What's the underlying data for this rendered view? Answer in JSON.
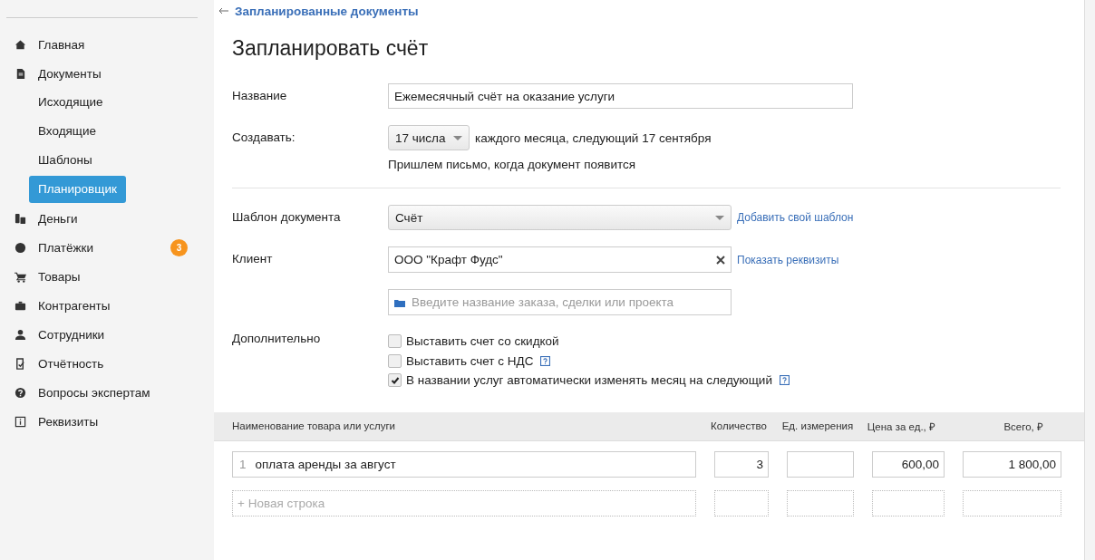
{
  "sidebar": {
    "items": [
      {
        "label": "Главная",
        "selected": false
      },
      {
        "label": "Документы",
        "selected": false,
        "children": [
          {
            "label": "Исходящие",
            "selected": false
          },
          {
            "label": "Входящие",
            "selected": false
          },
          {
            "label": "Шаблоны",
            "selected": false
          },
          {
            "label": "Планировщик",
            "selected": true
          }
        ]
      },
      {
        "label": "Деньги",
        "selected": false
      },
      {
        "label": "Платёжки",
        "selected": false,
        "badge": "3"
      },
      {
        "label": "Товары",
        "selected": false
      },
      {
        "label": "Контрагенты",
        "selected": false
      },
      {
        "label": "Сотрудники",
        "selected": false
      },
      {
        "label": "Отчётность",
        "selected": false
      },
      {
        "label": "Вопросы экспертам",
        "selected": false
      },
      {
        "label": "Реквизиты",
        "selected": false
      }
    ]
  },
  "back_link": "Запланированные документы",
  "title": "Запланировать счёт",
  "form": {
    "name": {
      "label": "Название",
      "value": "Ежемесячный счёт на оказание услуги"
    },
    "create": {
      "label": "Создавать:",
      "day": "17 числа",
      "text": "каждого месяца, следующий 17 сентября",
      "note": "Пришлем письмо, когда документ появится"
    },
    "template": {
      "label": "Шаблон документа",
      "value": "Счёт",
      "link": "Добавить свой шаблон"
    },
    "client": {
      "label": "Клиент",
      "value": "ООО \"Крафт Фудс\"",
      "link": "Показать реквизиты"
    },
    "project": {
      "placeholder": "Введите название заказа, сделки или проекта"
    },
    "extra": {
      "label": "Дополнительно",
      "options": [
        {
          "label": "Выставить счет со скидкой",
          "checked": false,
          "help": false
        },
        {
          "label": "Выставить счет с НДС",
          "checked": false,
          "help": true
        },
        {
          "label": "В названии услуг автоматически изменять месяц на следующий",
          "checked": true,
          "help": true
        }
      ]
    }
  },
  "table": {
    "columns": [
      "Наименование товара или услуги",
      "Количество",
      "Ед. измерения",
      "Цена за ед., ₽",
      "Всего, ₽"
    ],
    "rows": [
      {
        "number": "1",
        "name": "оплата аренды за август",
        "quantity": "3",
        "price": "600,00",
        "total": "1 800,00"
      }
    ],
    "new_row": {
      "placeholder": "+ Новая строка"
    }
  }
}
